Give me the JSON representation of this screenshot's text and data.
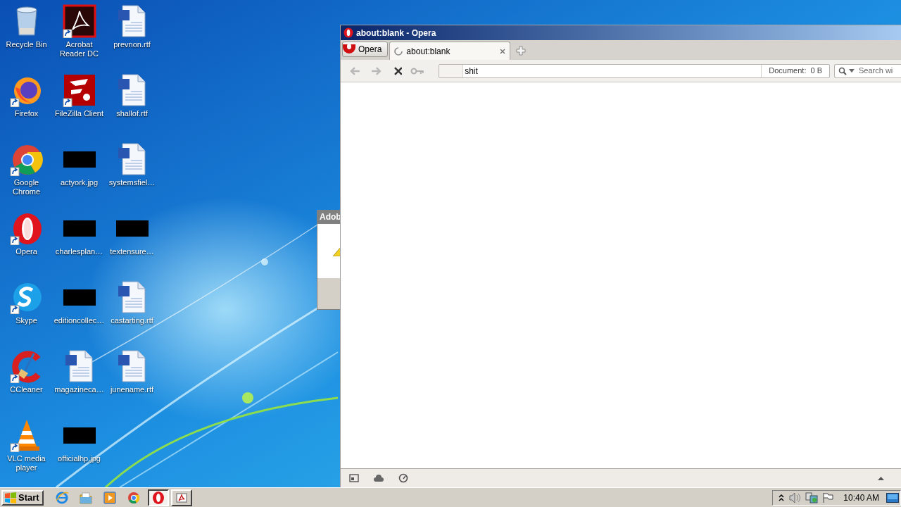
{
  "desktop": {
    "icons": [
      {
        "label": "Recycle Bin",
        "kind": "recycle",
        "shortcut": false
      },
      {
        "label": "Acrobat Reader DC",
        "kind": "acrobat",
        "shortcut": true
      },
      {
        "label": "prevnon.rtf",
        "kind": "word",
        "shortcut": false
      },
      {
        "label": "Firefox",
        "kind": "firefox",
        "shortcut": true
      },
      {
        "label": "FileZilla Client",
        "kind": "filezilla",
        "shortcut": true
      },
      {
        "label": "shallof.rtf",
        "kind": "word",
        "shortcut": false
      },
      {
        "label": "Google Chrome",
        "kind": "chrome",
        "shortcut": true
      },
      {
        "label": "actyork.jpg",
        "kind": "thumbnail",
        "shortcut": false
      },
      {
        "label": "systemsfiel…",
        "kind": "word",
        "shortcut": false
      },
      {
        "label": "Opera",
        "kind": "opera",
        "shortcut": true
      },
      {
        "label": "charlesplan…",
        "kind": "thumbnail",
        "shortcut": false
      },
      {
        "label": "textensure…",
        "kind": "thumbnail",
        "shortcut": false
      },
      {
        "label": "Skype",
        "kind": "skype",
        "shortcut": true
      },
      {
        "label": "editioncollec…",
        "kind": "thumbnail",
        "shortcut": false
      },
      {
        "label": "castarting.rtf",
        "kind": "word",
        "shortcut": false
      },
      {
        "label": "CCleaner",
        "kind": "ccleaner",
        "shortcut": true
      },
      {
        "label": "magazineca…",
        "kind": "word",
        "shortcut": false
      },
      {
        "label": "junename.rtf",
        "kind": "word",
        "shortcut": false
      },
      {
        "label": "VLC media player",
        "kind": "vlc",
        "shortcut": true
      },
      {
        "label": "officialhp.jpg",
        "kind": "thumbnail",
        "shortcut": false
      }
    ]
  },
  "background_dialog": {
    "title": "Adob"
  },
  "browser": {
    "window_title": "about:blank - Opera",
    "menu_button": "Opera",
    "tabs": [
      {
        "label": "about:blank",
        "selected": true,
        "loading": true
      }
    ],
    "back_enabled": false,
    "forward_enabled": false,
    "address": {
      "value": "shit"
    },
    "document_label": "Document:",
    "document_size": "0 B",
    "search": {
      "placeholder": "Search wi"
    }
  },
  "taskbar": {
    "start": "Start",
    "pinned": [
      {
        "kind": "ie"
      },
      {
        "kind": "folder"
      },
      {
        "kind": "media"
      },
      {
        "kind": "chrome"
      }
    ],
    "tasks": [
      {
        "kind": "opera",
        "selected": true
      },
      {
        "kind": "acrobat",
        "selected": false
      }
    ],
    "clock": "10:40 AM"
  }
}
